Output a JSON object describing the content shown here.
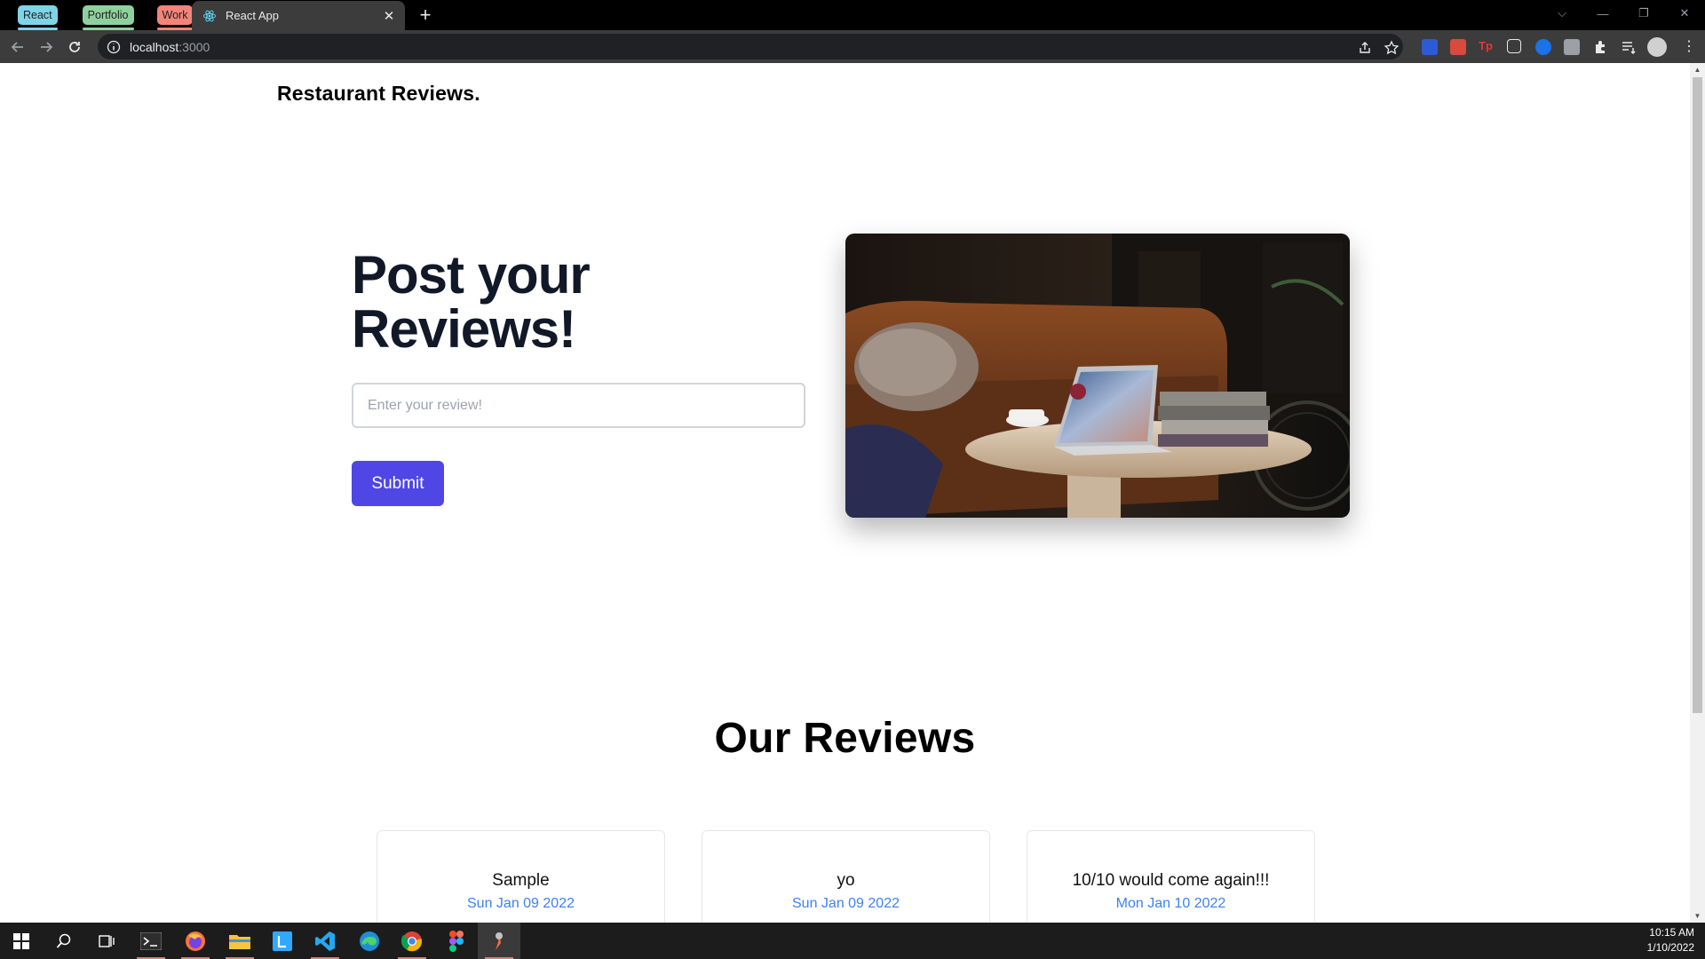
{
  "browser": {
    "tab_groups": [
      {
        "label": "React",
        "color": "#7fd4e8"
      },
      {
        "label": "Portfolio",
        "color": "#8fd19e"
      },
      {
        "label": "Work",
        "color": "#f2847a"
      }
    ],
    "active_tab": {
      "title": "React App",
      "icon": "react-icon"
    },
    "address": {
      "host": "localhost",
      "port": ":3000"
    }
  },
  "page": {
    "brand": "Restaurant Reviews.",
    "hero": {
      "title": "Post your Reviews!",
      "input_placeholder": "Enter your review!",
      "input_value": "",
      "submit_label": "Submit",
      "image_alt": "laptop on a round table in front of a leather sofa"
    },
    "reviews_heading": "Our Reviews",
    "reviews": [
      {
        "text": "Sample",
        "date": "Sun Jan 09 2022"
      },
      {
        "text": "yo",
        "date": "Sun Jan 09 2022"
      },
      {
        "text": "10/10 would come again!!!",
        "date": "Mon Jan 10 2022"
      }
    ],
    "accent_color": "#4f46e5",
    "date_color": "#3b82f6"
  },
  "taskbar": {
    "apps": [
      "start-icon",
      "search-icon",
      "task-view-icon",
      "terminal-icon",
      "firefox-icon",
      "file-explorer-icon",
      "lightroom-icon",
      "vscode-icon",
      "edge-icon",
      "chrome-icon",
      "figma-icon",
      "postman-icon"
    ],
    "time": "10:15 AM",
    "date": "1/10/2022"
  }
}
